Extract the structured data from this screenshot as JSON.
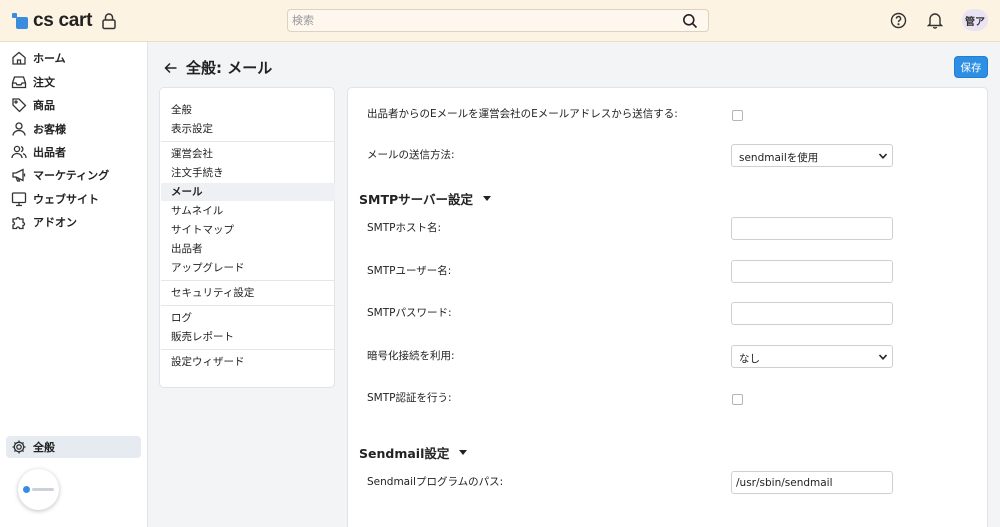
{
  "app": {
    "logo_text": "cs cart"
  },
  "search": {
    "placeholder": "検索",
    "value": ""
  },
  "header": {
    "avatar_initials": "管ア"
  },
  "sidebar": {
    "items": [
      {
        "label": "ホーム",
        "icon": "home-icon"
      },
      {
        "label": "注文",
        "icon": "inbox-icon"
      },
      {
        "label": "商品",
        "icon": "tag-icon"
      },
      {
        "label": "お客様",
        "icon": "user-icon"
      },
      {
        "label": "出品者",
        "icon": "users-icon"
      },
      {
        "label": "マーケティング",
        "icon": "megaphone-icon"
      },
      {
        "label": "ウェブサイト",
        "icon": "monitor-icon"
      },
      {
        "label": "アドオン",
        "icon": "puzzle-icon"
      }
    ],
    "bottom_item": {
      "label": "全般",
      "icon": "gear-icon"
    }
  },
  "page": {
    "title": "全般: メール",
    "save_label": "保存"
  },
  "sections": {
    "items": [
      "全般",
      "表示設定",
      "運営会社",
      "注文手続き",
      "メール",
      "サムネイル",
      "サイトマップ",
      "出品者",
      "アップグレード",
      "セキュリティ設定",
      "ログ",
      "販売レポート",
      "設定ウィザード"
    ],
    "active": "メール"
  },
  "form": {
    "send_from_company_label": "出品者からのEメールを運営会社のEメールアドレスから送信する:",
    "send_from_company_checked": false,
    "send_method_label": "メールの送信方法:",
    "send_method_value": "sendmailを使用",
    "smtp_heading": "SMTPサーバー設定",
    "smtp_host_label": "SMTPホスト名:",
    "smtp_host_value": "",
    "smtp_user_label": "SMTPユーザー名:",
    "smtp_user_value": "",
    "smtp_password_label": "SMTPパスワード:",
    "smtp_password_value": "",
    "encryption_label": "暗号化接続を利用:",
    "encryption_value": "なし",
    "smtp_auth_label": "SMTP認証を行う:",
    "smtp_auth_checked": false,
    "sendmail_heading": "Sendmail設定",
    "sendmail_path_label": "Sendmailプログラムのパス:",
    "sendmail_path_value": "/usr/sbin/sendmail"
  }
}
